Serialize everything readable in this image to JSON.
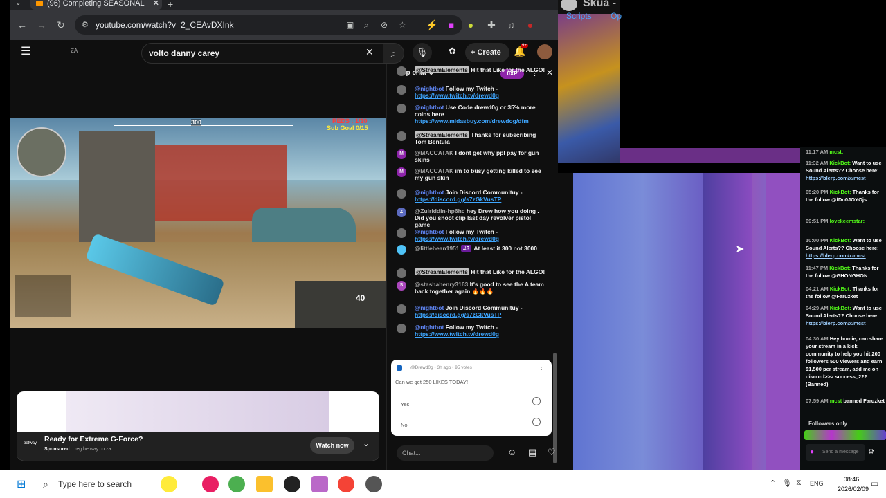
{
  "browser": {
    "tab_title": "(96) Completing SEASONAL",
    "url": "youtube.com/watch?v=2_CEAvDXInk"
  },
  "youtube": {
    "logo_text": "ZA",
    "search_value": "volto danny carey",
    "create_label": "Create",
    "notification_count": "9+",
    "video": {
      "reds_text": "REDS : 1/10",
      "sub_goal_text": "Sub Goal 0/15",
      "compass_value": "300",
      "ammo_text": "40"
    },
    "ad": {
      "headline": "Ready for Extreme G-Force?",
      "sponsored_label": "Sponsored",
      "domain": "reg.betway.co.za",
      "brand": "betway",
      "cta_label": "Watch now"
    }
  },
  "chat": {
    "header_label": "Top chat",
    "xp_label": "0XP",
    "input_placeholder": "Chat...",
    "messages": [
      {
        "author": "@StreamElements",
        "text": "Hit that Like for the ALGO!",
        "color": "#6f6f6f"
      },
      {
        "author": "@nightbot",
        "text": "Follow my Twitch - ",
        "link": "https://www.twitch.tv/drewd0g",
        "color": "#6f6f6f"
      },
      {
        "author": "@nightbot",
        "text": "Use Code drewd0g or 35% more coins here ",
        "link": "https://www.midasbuy.com/drewdog/dfm",
        "color": "#6f6f6f"
      },
      {
        "author": "@StreamElements",
        "text": "Thanks for subscribing Tom Bentula",
        "color": "#6f6f6f"
      },
      {
        "author": "@MACCATAK",
        "text": "I dont get why ppl pay for gun skins",
        "color": "#8e24aa",
        "initial": "M"
      },
      {
        "author": "@MACCATAK",
        "text": "im to busy getting killed to see my gun skin",
        "color": "#8e24aa",
        "initial": "M"
      },
      {
        "author": "@nightbot",
        "text": "Join Discord Communituy - ",
        "link": "https://discord.gg/s7zGkVusTP",
        "color": "#6f6f6f"
      },
      {
        "author": "@Zulriddin-hp6hc",
        "text": "hey Drew how you doing . Did you shoot clip last day revolver pistol game",
        "color": "#5c6bc0",
        "initial": "Z"
      },
      {
        "author": "@nightbot",
        "text": "Follow my Twitch - ",
        "link": "https://www.twitch.tv/drewd0g",
        "color": "#6f6f6f"
      },
      {
        "author": "@littlebean1951",
        "text": "At least it 300 not 3000",
        "color": "#4fc3f7",
        "badge": "#3"
      },
      {
        "author": "@StreamElements",
        "text": "Hit that Like for the ALGO!",
        "color": "#6f6f6f"
      },
      {
        "author": "@stashahenry3163",
        "text": "It's good to see the A team back together again 🔥🔥🔥",
        "color": "#ab47bc",
        "initial": "S"
      },
      {
        "author": "@nightbot",
        "text": "Join Discord Communituy - ",
        "link": "https://discord.gg/s7zGkVusTP",
        "color": "#6f6f6f"
      },
      {
        "author": "@nightbot",
        "text": "Follow my Twitch - ",
        "link": "https://www.twitch.tv/drewd0g",
        "color": "#6f6f6f"
      }
    ],
    "poll": {
      "meta": "@Drewd0g • 3h ago • 95 votes",
      "question": "Can we get 250 LIKES TODAY!",
      "options": [
        "Yes",
        "No"
      ]
    }
  },
  "skua": {
    "title": "Skua -",
    "menu": [
      "Scripts",
      "Op"
    ]
  },
  "kick": {
    "messages": [
      {
        "time": "11:17 AM",
        "user": "mcst:",
        "text": ""
      },
      {
        "time": "11:32 AM",
        "user": "KickBot:",
        "text": "Want to use Sound Alerts?? Choose here: ",
        "link": "https://blerp.com/x/mcst"
      },
      {
        "time": "05:20 PM",
        "user": "KickBot:",
        "text": "Thanks for the follow @fDn0JOYOjs"
      },
      {
        "time": "09:51 PM",
        "user": "lovekeemstar:",
        "text": ""
      },
      {
        "time": "10:00 PM",
        "user": "KickBot:",
        "text": "Want to use Sound Alerts?? Choose here: ",
        "link": "https://blerp.com/x/mcst"
      },
      {
        "time": "11:47 PM",
        "user": "KickBot:",
        "text": "Thanks for the follow @GHONGHON"
      },
      {
        "time": "04:21 AM",
        "user": "KickBot:",
        "text": "Thanks for the follow @Faruzket"
      },
      {
        "time": "04:29 AM",
        "user": "KickBot:",
        "text": "Want to use Sound Alerts?? Choose here: ",
        "link": "https://blerp.com/x/mcst"
      },
      {
        "time": "04:30 AM",
        "user": "",
        "text": "Hey homie, can share your stream in a kick community to help you hit 200 followers 500 viewers and earn $1,500 per stream, add me on discord>>> success_222 (Banned)"
      },
      {
        "time": "07:59 AM",
        "user": "mcst",
        "text": "banned Faruzket"
      }
    ],
    "followers_only": "Followers only",
    "send_label": "Send a message"
  },
  "taskbar": {
    "search_placeholder": "Type here to search",
    "language": "ENG",
    "time": "08:46",
    "date": "2026/02/09"
  },
  "colors": {
    "youtube_bg": "#0f0f0f",
    "kick_green": "#53fc18",
    "link_blue": "#3ea6ff",
    "forest_purple": "#7a5fd0"
  }
}
